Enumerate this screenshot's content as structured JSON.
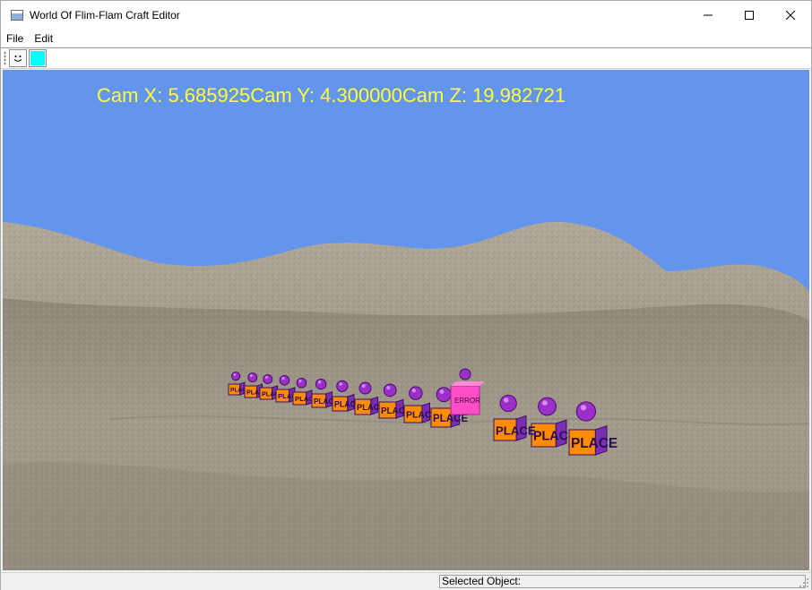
{
  "window": {
    "title": "World Of Flim-Flam Craft Editor",
    "controls": [
      "minimize",
      "maximize",
      "close"
    ]
  },
  "menu": {
    "items": [
      "File",
      "Edit"
    ]
  },
  "toolbar": {
    "buttons": [
      {
        "icon": "smiley-icon"
      },
      {
        "icon": "color-swatch",
        "color": "#00ffff"
      }
    ]
  },
  "viewport": {
    "sky_color": "#6495ed",
    "readout_color": "#ffff33",
    "camera_readout": "Cam X: 5.685925Cam Y: 4.300000Cam Z: 19.982721",
    "block_label": "PLACE",
    "selected_block_label": "ERROR",
    "object_colors": {
      "block": "#ff8c00",
      "sphere": "#9b30c8",
      "selected": "#ff4fc8"
    }
  },
  "statusbar": {
    "selected_object_label": "Selected Object:"
  }
}
